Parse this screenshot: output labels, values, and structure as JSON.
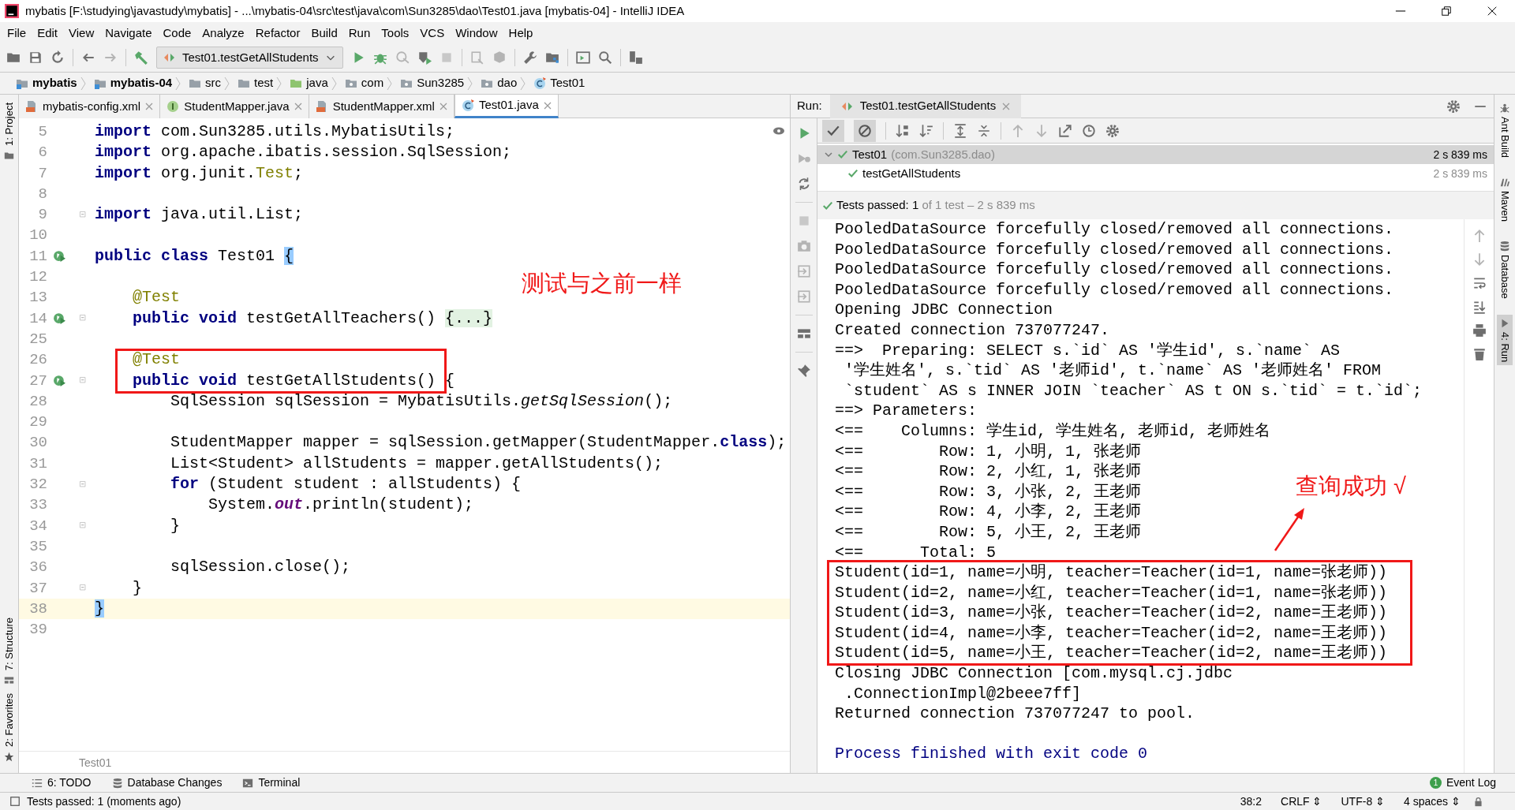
{
  "window": {
    "title": "mybatis [F:\\studying\\javastudy\\mybatis] - ...\\mybatis-04\\src\\test\\java\\com\\Sun3285\\dao\\Test01.java [mybatis-04] - IntelliJ IDEA"
  },
  "menu": [
    "File",
    "Edit",
    "View",
    "Navigate",
    "Code",
    "Analyze",
    "Refactor",
    "Build",
    "Run",
    "Tools",
    "VCS",
    "Window",
    "Help"
  ],
  "toolbar": {
    "run_config": "Test01.testGetAllStudents"
  },
  "breadcrumbs": [
    {
      "label": "mybatis",
      "kind": "module"
    },
    {
      "label": "mybatis-04",
      "kind": "module"
    },
    {
      "label": "src",
      "kind": "folder"
    },
    {
      "label": "test",
      "kind": "folder"
    },
    {
      "label": "java",
      "kind": "source"
    },
    {
      "label": "com",
      "kind": "package"
    },
    {
      "label": "Sun3285",
      "kind": "package"
    },
    {
      "label": "dao",
      "kind": "package"
    },
    {
      "label": "Test01",
      "kind": "class"
    }
  ],
  "left_stripe": [
    "1: Project",
    "7: Structure",
    "2: Favorites"
  ],
  "editor_tabs": [
    {
      "label": "mybatis-config.xml",
      "kind": "xml",
      "selected": false
    },
    {
      "label": "StudentMapper.java",
      "kind": "interface",
      "selected": false
    },
    {
      "label": "StudentMapper.xml",
      "kind": "xml",
      "selected": false
    },
    {
      "label": "Test01.java",
      "kind": "class",
      "selected": true
    }
  ],
  "code_lines": [
    {
      "number": "5",
      "segs": [
        {
          "kind": "kw",
          "text": "import"
        },
        {
          "kind": "tx",
          "text": " com.Sun3285.utils.MybatisUtils;"
        }
      ]
    },
    {
      "number": "6",
      "segs": [
        {
          "kind": "kw",
          "text": "import"
        },
        {
          "kind": "tx",
          "text": " org.apache.ibatis.session.SqlSession;"
        }
      ]
    },
    {
      "number": "7",
      "segs": [
        {
          "kind": "kw",
          "text": "import"
        },
        {
          "kind": "tx",
          "text": " org.junit."
        },
        {
          "kind": "an",
          "text": "Test"
        },
        {
          "kind": "tx",
          "text": ";"
        }
      ]
    },
    {
      "number": "8"
    },
    {
      "number": "9",
      "segs": [
        {
          "kind": "kw",
          "text": "import"
        },
        {
          "kind": "tx",
          "text": " java.util.List;"
        }
      ],
      "fold": true
    },
    {
      "number": "10"
    },
    {
      "number": "11",
      "segs": [
        {
          "kind": "kw",
          "text": "public class"
        },
        {
          "kind": "tx",
          "text": " Test01 "
        },
        {
          "kind": "br",
          "text": "{"
        }
      ],
      "run": true
    },
    {
      "number": "12"
    },
    {
      "number": "13",
      "segs": [
        {
          "kind": "an",
          "text": "    @Test"
        }
      ]
    },
    {
      "number": "14",
      "segs": [
        {
          "kind": "kw",
          "text": "    public void"
        },
        {
          "kind": "tx",
          "text": " testGetAllTeachers() "
        },
        {
          "kind": "fd",
          "text": "{...}"
        }
      ],
      "run": true,
      "fold": true
    },
    {
      "number": "25"
    },
    {
      "number": "26",
      "segs": [
        {
          "kind": "an",
          "text": "    @Test"
        }
      ],
      "boxed": true
    },
    {
      "number": "27",
      "segs": [
        {
          "kind": "kw",
          "text": "    public void"
        },
        {
          "kind": "tx",
          "text": " testGetAllStudents() {"
        }
      ],
      "run": true,
      "boxed": true,
      "fold": true
    },
    {
      "number": "28",
      "segs": [
        {
          "kind": "tx",
          "text": "        SqlSession sqlSession = MybatisUtils."
        },
        {
          "kind": "it",
          "text": "getSqlSession"
        },
        {
          "kind": "tx",
          "text": "();"
        }
      ]
    },
    {
      "number": "29"
    },
    {
      "number": "30",
      "segs": [
        {
          "kind": "tx",
          "text": "        StudentMapper mapper = sqlSession.getMapper(StudentMapper."
        },
        {
          "kind": "kw",
          "text": "class"
        },
        {
          "kind": "tx",
          "text": ");"
        }
      ]
    },
    {
      "number": "31",
      "segs": [
        {
          "kind": "tx",
          "text": "        List<Student> allStudents = mapper.getAllStudents();"
        }
      ]
    },
    {
      "number": "32",
      "segs": [
        {
          "kind": "kw",
          "text": "        for"
        },
        {
          "kind": "tx",
          "text": " (Student student : allStudents) {"
        }
      ],
      "fold": true
    },
    {
      "number": "33",
      "segs": [
        {
          "kind": "tx",
          "text": "            System."
        },
        {
          "kind": "st",
          "text": "out"
        },
        {
          "kind": "tx",
          "text": ".println(student);"
        }
      ]
    },
    {
      "number": "34",
      "segs": [
        {
          "kind": "tx",
          "text": "        }"
        }
      ],
      "fold": true
    },
    {
      "number": "35"
    },
    {
      "number": "36",
      "segs": [
        {
          "kind": "tx",
          "text": "        sqlSession.close();"
        }
      ]
    },
    {
      "number": "37",
      "segs": [
        {
          "kind": "tx",
          "text": "    }"
        }
      ],
      "fold": true
    },
    {
      "number": "38",
      "segs": [
        {
          "kind": "br",
          "text": "}"
        }
      ],
      "current": true
    },
    {
      "number": "39"
    }
  ],
  "editor_note": "测试与之前一样",
  "editor_breadcrumb": "Test01",
  "run": {
    "label": "Run:",
    "tab": "Test01.testGetAllStudents",
    "tree": [
      {
        "name": "Test01",
        "detail": "(com.Sun3285.dao)",
        "time": "2 s 839 ms",
        "selected": true,
        "children": [
          {
            "name": "testGetAllStudents",
            "time": "2 s 839 ms",
            "selected": false
          }
        ]
      }
    ],
    "status": {
      "passed": "Tests passed: 1",
      "rest": "of 1 test – 2 s 839 ms"
    },
    "console": [
      {
        "text": "PooledDataSource forcefully closed/removed all connections.",
        "kind": "out"
      },
      {
        "text": "PooledDataSource forcefully closed/removed all connections.",
        "kind": "out"
      },
      {
        "text": "PooledDataSource forcefully closed/removed all connections.",
        "kind": "out"
      },
      {
        "text": "PooledDataSource forcefully closed/removed all connections.",
        "kind": "out"
      },
      {
        "text": "Opening JDBC Connection",
        "kind": "out"
      },
      {
        "text": "Created connection 737077247.",
        "kind": "out"
      },
      {
        "text": "==>  Preparing: SELECT s.`id` AS '学生id', s.`name` AS",
        "kind": "out"
      },
      {
        "text": " '学生姓名', s.`tid` AS '老师id', t.`name` AS '老师姓名' FROM",
        "kind": "out"
      },
      {
        "text": " `student` AS s INNER JOIN `teacher` AS t ON s.`tid` = t.`id`;",
        "kind": "out"
      },
      {
        "text": "==> Parameters: ",
        "kind": "out"
      },
      {
        "text": "<==    Columns: 学生id, 学生姓名, 老师id, 老师姓名",
        "kind": "out"
      },
      {
        "text": "<==        Row: 1, 小明, 1, 张老师",
        "kind": "out"
      },
      {
        "text": "<==        Row: 2, 小红, 1, 张老师",
        "kind": "out"
      },
      {
        "text": "<==        Row: 3, 小张, 2, 王老师",
        "kind": "out"
      },
      {
        "text": "<==        Row: 4, 小李, 2, 王老师",
        "kind": "out"
      },
      {
        "text": "<==        Row: 5, 小王, 2, 王老师",
        "kind": "out"
      },
      {
        "text": "<==      Total: 5",
        "kind": "out"
      },
      {
        "text": "Student(id=1, name=小明, teacher=Teacher(id=1, name=张老师))",
        "kind": "out",
        "boxed": true
      },
      {
        "text": "Student(id=2, name=小红, teacher=Teacher(id=1, name=张老师))",
        "kind": "out",
        "boxed": true
      },
      {
        "text": "Student(id=3, name=小张, teacher=Teacher(id=2, name=王老师))",
        "kind": "out",
        "boxed": true
      },
      {
        "text": "Student(id=4, name=小李, teacher=Teacher(id=2, name=王老师))",
        "kind": "out",
        "boxed": true
      },
      {
        "text": "Student(id=5, name=小王, teacher=Teacher(id=2, name=王老师))",
        "kind": "out",
        "boxed": true
      },
      {
        "text": "Closing JDBC Connection [com.mysql.cj.jdbc",
        "kind": "out"
      },
      {
        "text": " .ConnectionImpl@2beee7ff]",
        "kind": "out"
      },
      {
        "text": "Returned connection 737077247 to pool.",
        "kind": "out"
      },
      {
        "kind": "blank"
      },
      {
        "text": "Process finished with exit code 0",
        "kind": "exit"
      }
    ],
    "note": "查询成功 √"
  },
  "right_stripe": [
    {
      "label": "Ant Build",
      "kind": "ant",
      "selected": false
    },
    {
      "label": "Maven",
      "kind": "maven",
      "selected": false
    },
    {
      "label": "Database",
      "kind": "database",
      "selected": false
    },
    {
      "label": "4: Run",
      "kind": "run",
      "selected": true
    }
  ],
  "bottom_tools": [
    {
      "label": "6: TODO",
      "kind": "todo"
    },
    {
      "label": "Database Changes",
      "kind": "database"
    },
    {
      "label": "Terminal",
      "kind": "terminal"
    }
  ],
  "event_log": {
    "label": "Event Log",
    "badge": "1"
  },
  "status_bar": {
    "message": "Tests passed: 1 (moments ago)",
    "items": [
      "38:2",
      "CRLF ⇕",
      "UTF-8 ⇕",
      "4 spaces ⇕"
    ]
  }
}
